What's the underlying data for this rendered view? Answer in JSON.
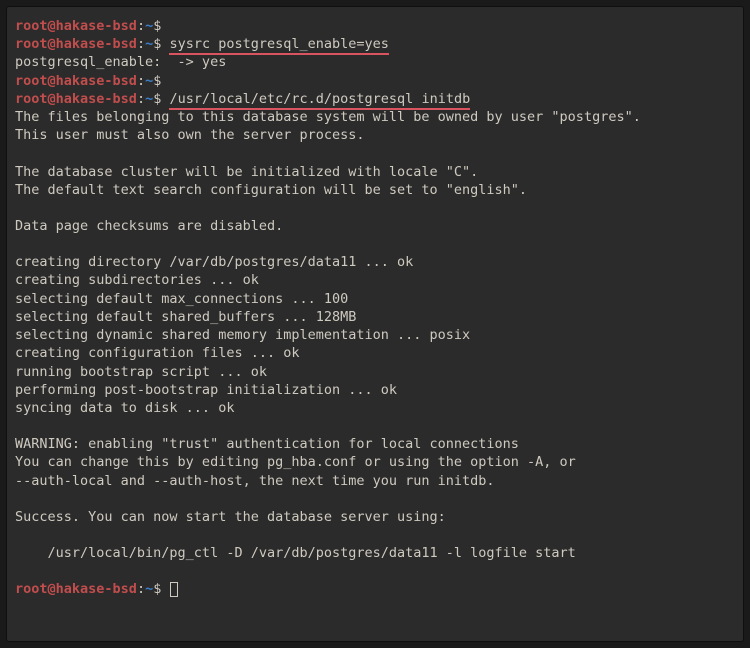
{
  "prompt": {
    "user": "root",
    "at": "@",
    "host": "hakase-bsd",
    "colon": ":",
    "path": "~",
    "sigil": "$ "
  },
  "cmd": {
    "sysrc": "sysrc postgresql_enable=yes",
    "initdb": "/usr/local/etc/rc.d/postgresql initdb"
  },
  "out": {
    "sysrc_result": "postgresql_enable:  -> yes",
    "l01": "The files belonging to this database system will be owned by user \"postgres\".",
    "l02": "This user must also own the server process.",
    "l03": "The database cluster will be initialized with locale \"C\".",
    "l04": "The default text search configuration will be set to \"english\".",
    "l05": "Data page checksums are disabled.",
    "l06": "creating directory /var/db/postgres/data11 ... ok",
    "l07": "creating subdirectories ... ok",
    "l08": "selecting default max_connections ... 100",
    "l09": "selecting default shared_buffers ... 128MB",
    "l10": "selecting dynamic shared memory implementation ... posix",
    "l11": "creating configuration files ... ok",
    "l12": "running bootstrap script ... ok",
    "l13": "performing post-bootstrap initialization ... ok",
    "l14": "syncing data to disk ... ok",
    "l15": "WARNING: enabling \"trust\" authentication for local connections",
    "l16": "You can change this by editing pg_hba.conf or using the option -A, or",
    "l17": "--auth-local and --auth-host, the next time you run initdb.",
    "l18": "Success. You can now start the database server using:",
    "l19": "    /usr/local/bin/pg_ctl -D /var/db/postgres/data11 -l logfile start"
  }
}
